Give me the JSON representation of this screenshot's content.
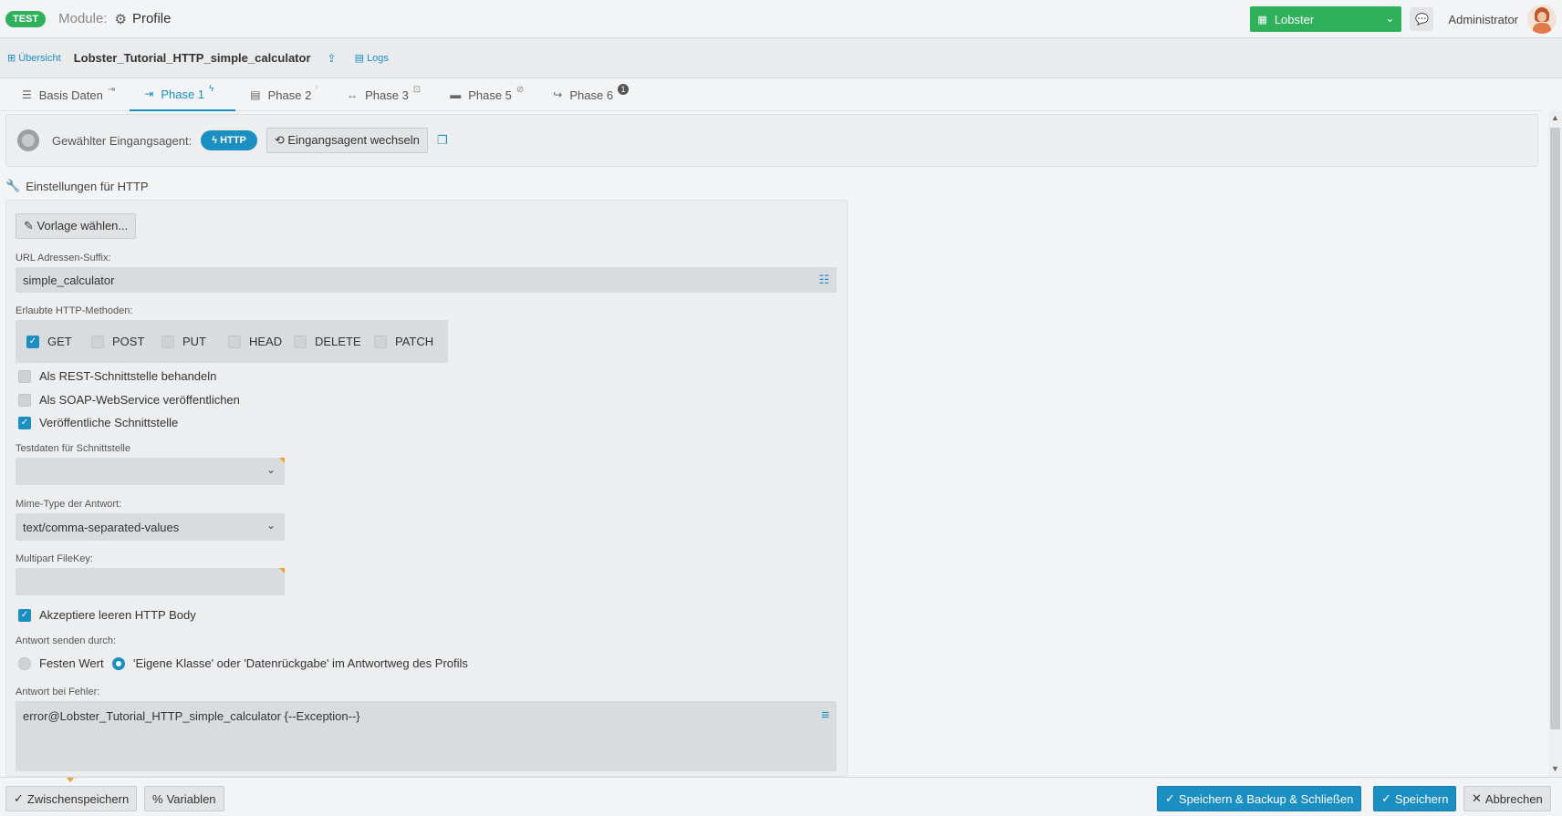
{
  "header": {
    "env_badge": "TEST",
    "module_label": "Module:",
    "module_name": "Profile",
    "tenant": "Lobster",
    "user": "Administrator"
  },
  "breadcrumb": {
    "overview": "Übersicht",
    "profile_title": "Lobster_Tutorial_HTTP_simple_calculator",
    "logs": "Logs"
  },
  "tabs": [
    {
      "label": "Basis Daten",
      "icon": "sign-in-icon"
    },
    {
      "label": "Phase 1",
      "icon": "bolt-icon"
    },
    {
      "label": "Phase 2",
      "icon": "info-icon"
    },
    {
      "label": "Phase 3",
      "icon": "resize-icon"
    },
    {
      "label": "Phase 5",
      "icon": "ban-icon"
    },
    {
      "label": "Phase 6",
      "icon": "count-badge",
      "badge": "1"
    }
  ],
  "agent": {
    "label": "Gewählter Eingangsagent:",
    "agent_name": "HTTP",
    "switch_label": "Eingangsagent wechseln"
  },
  "section_title": "Einstellungen für HTTP",
  "form": {
    "template_button": "Vorlage wählen...",
    "url_suffix_label": "URL Adressen-Suffix:",
    "url_suffix_value": "simple_calculator",
    "methods_label": "Erlaubte HTTP-Methoden:",
    "methods": [
      {
        "label": "GET",
        "checked": true
      },
      {
        "label": "POST",
        "checked": false
      },
      {
        "label": "PUT",
        "checked": false
      },
      {
        "label": "HEAD",
        "checked": false
      },
      {
        "label": "DELETE",
        "checked": false
      },
      {
        "label": "PATCH",
        "checked": false
      }
    ],
    "rest_label": "Als REST-Schnittstelle behandeln",
    "soap_label": "Als SOAP-WebService veröffentlichen",
    "public_label": "Veröffentliche Schnittstelle",
    "testdata_label": "Testdaten für Schnittstelle",
    "testdata_value": "",
    "mime_label": "Mime-Type der Antwort:",
    "mime_value": "text/comma-separated-values",
    "multipart_label": "Multipart FileKey:",
    "multipart_value": "",
    "empty_body_label": "Akzeptiere leeren HTTP Body",
    "response_by_label": "Antwort senden durch:",
    "response_fixed": "Festen Wert",
    "response_class": "'Eigene Klasse' oder 'Datenrückgabe' im Antwortweg des Profils",
    "error_label": "Antwort bei Fehler:",
    "error_value": "error@Lobster_Tutorial_HTTP_simple_calculator {--Exception--}"
  },
  "footer": {
    "save_temp": "Zwischenspeichern",
    "variables": "Variablen",
    "save_backup_close": "Speichern & Backup & Schließen",
    "save": "Speichern",
    "cancel": "Abbrechen"
  },
  "colors": {
    "accent_blue": "#1b8ec2",
    "green": "#2fb15b"
  }
}
